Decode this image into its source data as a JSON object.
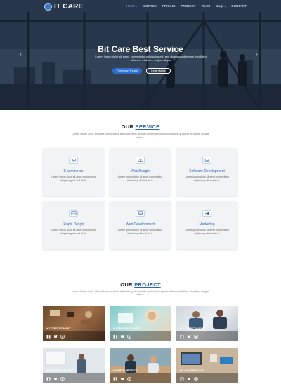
{
  "brand": {
    "name": "IT CARE"
  },
  "nav": {
    "items": [
      {
        "label": "Home",
        "active": true,
        "dropdown": true
      },
      {
        "label": "SERVICE",
        "active": false,
        "dropdown": false
      },
      {
        "label": "PRICING",
        "active": false,
        "dropdown": false
      },
      {
        "label": "PROJECT",
        "active": false,
        "dropdown": false
      },
      {
        "label": "TEAM",
        "active": false,
        "dropdown": false
      },
      {
        "label": "Blogs",
        "active": false,
        "dropdown": true
      },
      {
        "label": "CONTACT",
        "active": false,
        "dropdown": false
      }
    ]
  },
  "hero": {
    "title": "Bit Care Best Service",
    "description": "Lorem ipsum dolor sit amet, consectetur adipisicing elit, sed do eiusmod tempor incididunt ut labore et dolore magna aliqua.",
    "primary_button": "Purchase Theme",
    "secondary_button": "Learn More",
    "prev_icon": "chevron-left-icon",
    "next_icon": "chevron-right-icon"
  },
  "service": {
    "title_plain": "OUR",
    "title_accent": "SERVICE",
    "description": "Lorem ipsum dolor sit amet, consectetur adipisicing elit, sed do eiusmod tempor incididunt ut labore et dolore magna aliqua.",
    "cards": [
      {
        "icon": "cart-icon",
        "title": "E commerce",
        "text": "Lorem ipsum dolor sit amet consectetur adipiscing elit sed do it."
      },
      {
        "icon": "download-icon",
        "title": "Web Desgin",
        "text": "Lorem ipsum dolor sit amet consectetur adipiscing elit sed do it."
      },
      {
        "icon": "chart-icon",
        "title": "Software Development",
        "text": "Lorem ipsum dolor sit amet consectetur adipiscing elit sed do it."
      },
      {
        "icon": "image-icon",
        "title": "Grapic Desgin",
        "text": "Lorem ipsum dolor sit amet consectetur adipiscing elit sed do it."
      },
      {
        "icon": "laptop-icon",
        "title": "Web Development",
        "text": "Lorem ipsum dolor sit amet consectetur adipiscing elit sed do it."
      },
      {
        "icon": "megaphone-icon",
        "title": "Marketing",
        "text": "Lorem ipsum dolor sit amet consectetur adipiscing elit sed do it."
      }
    ]
  },
  "project": {
    "title_plain": "OUR",
    "title_accent": "PROJECT",
    "description": "Lorem ipsum dolor sit amet, consectetur adipisicing elit, sed do eiusmod tempor incididunt ut labore et dolore magna aliqua.",
    "items": [
      {
        "title": "MY FIRST PROJECT"
      },
      {
        "title": "MY SECOND PROJECT"
      },
      {
        "title": "MY THIRD PROJECT"
      },
      {
        "title": "MY FOURTH PROJECT"
      },
      {
        "title": "MY FIFTH PROJECT"
      },
      {
        "title": "MY SIXTH PROJECT"
      }
    ],
    "social_icons": [
      "facebook-icon",
      "twitter-icon",
      "instagram-icon"
    ]
  },
  "colors": {
    "accent": "#2e63b8",
    "button": "#2e6dd1",
    "hero_bg": "#2d3b4f"
  }
}
